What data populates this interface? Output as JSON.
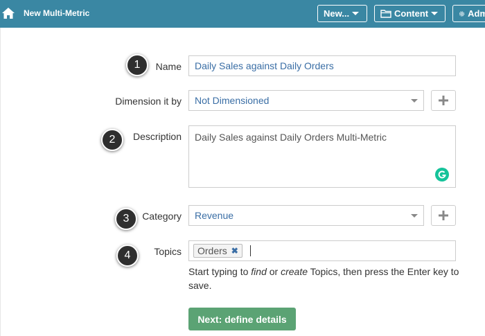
{
  "header": {
    "title": "New Multi-Metric",
    "buttons": {
      "new": "New...",
      "content": "Content",
      "admin": "Adm"
    }
  },
  "form": {
    "name": {
      "label": "Name",
      "value": "Daily Sales against Daily Orders"
    },
    "dimension": {
      "label": "Dimension it by",
      "value": "Not Dimensioned"
    },
    "description": {
      "label": "Description",
      "value": "Daily Sales against Daily Orders Multi-Metric"
    },
    "category": {
      "label": "Category",
      "value": "Revenue"
    },
    "topics": {
      "label": "Topics",
      "tags": [
        "Orders"
      ],
      "help_1": "Start typing to ",
      "help_find": "find",
      "help_2": " or ",
      "help_create": "create",
      "help_3": " Topics, then press the Enter key to save."
    },
    "next_button": "Next: define details"
  },
  "badges": [
    "1",
    "2",
    "3",
    "4"
  ],
  "colors": {
    "header": "#3a87a3",
    "next_button": "#5ba374",
    "grammarly": "#15c39a",
    "value_text": "#3a6ea5"
  },
  "icons": [
    "home-icon",
    "folder-icon",
    "gear-icon",
    "plus-icon",
    "grammarly-icon",
    "remove-tag-icon",
    "chevron-down-icon"
  ]
}
